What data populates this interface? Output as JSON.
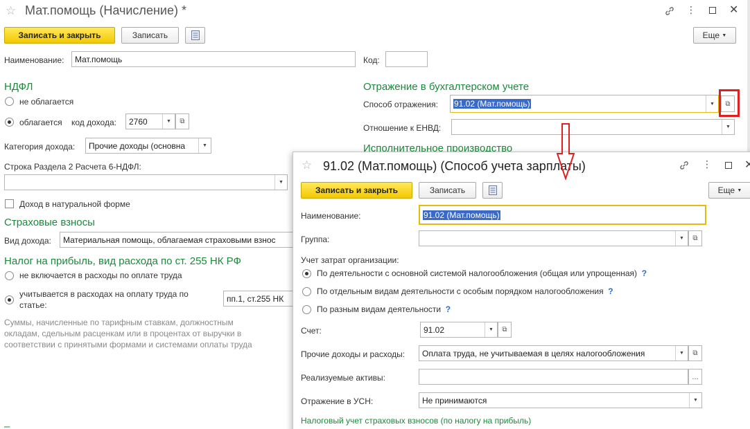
{
  "main": {
    "title": "Мат.помощь (Начисление) *",
    "toolbar": {
      "save_close": "Записать и закрыть",
      "save": "Записать",
      "more": "Еще"
    },
    "name_label": "Наименование:",
    "name_value": "Мат.помощь",
    "code_label": "Код:",
    "code_value": "",
    "ndfl": {
      "header": "НДФЛ",
      "opt1": "не облагается",
      "opt2": "облагается",
      "income_code_label": "код дохода:",
      "income_code_value": "2760",
      "category_label": "Категория дохода:",
      "category_value": "Прочие доходы (основна",
      "row_label": "Строка Раздела 2 Расчета 6-НДФЛ:",
      "row_value": "",
      "natural_label": "Доход в натуральной форме"
    },
    "insurance": {
      "header": "Страховые взносы",
      "income_type_label": "Вид дохода:",
      "income_type_value": "Материальная помощь, облагаемая страховыми взнос"
    },
    "tax": {
      "header": "Налог на прибыль, вид расхода по ст. 255 НК РФ",
      "opt1": "не включается в расходы по оплате труда",
      "opt2_line1": "учитывается в расходах на оплату труда по",
      "opt2_line2": "статье:",
      "article_value": "пп.1, ст.255 НК",
      "note1": "Суммы, начисленные по тарифным ставкам, должностным",
      "note2": "окладам, сдельным расценкам или в процентах от выручки в",
      "note3": "соответствии с принятыми формами и системами оплаты труда"
    },
    "accounting": {
      "header": "Отражение в бухгалтерском учете",
      "method_label": "Способ отражения:",
      "method_value": "91.02 (Мат.помощь)",
      "envd_label": "Отношение к ЕНВД:",
      "envd_value": "",
      "enforcement_header": "Исполнительное производство"
    }
  },
  "dialog": {
    "title": "91.02 (Мат.помощь) (Способ учета зарплаты)",
    "toolbar": {
      "save_close": "Записать и закрыть",
      "save": "Записать",
      "more": "Еще"
    },
    "name_label": "Наименование:",
    "name_value": "91.02 (Мат.помощь)",
    "group_label": "Группа:",
    "group_value": "",
    "costs_label": "Учет затрат организации:",
    "opt1": "По деятельности с основной системой налогообложения (общая или упрощенная)",
    "opt2": "По отдельным видам деятельности с особым порядком налогообложения",
    "opt3": "По разным видам деятельности",
    "help": "?",
    "account_label": "Счет:",
    "account_value": "91.02",
    "other_label": "Прочие доходы и расходы:",
    "other_value": "Оплата труда, не учитываемая в целях налогообложения",
    "assets_label": "Реализуемые активы:",
    "assets_value": "",
    "usn_label": "Отражение в УСН:",
    "usn_value": "Не принимаются",
    "footer_link": "Налоговый учет страховых взносов (по налогу на прибыль)"
  },
  "colors": {
    "accent_green": "#1a8a3a",
    "primary_button": "#f3c900",
    "highlight_red": "#e02020",
    "selection_blue": "#3a6ac8"
  }
}
